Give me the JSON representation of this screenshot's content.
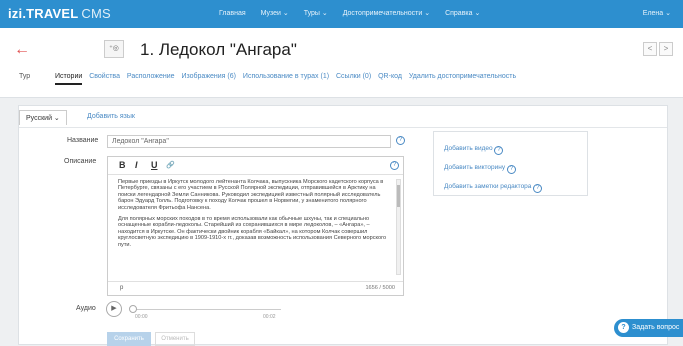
{
  "topbar": {
    "logo": "izi.TRAVEL",
    "logo_suffix": "CMS",
    "nav": [
      "Главная",
      "Музеи ⌄",
      "Туры ⌄",
      "Достопримечательности ⌄",
      "Справка ⌄"
    ],
    "user": "Елена ⌄"
  },
  "header": {
    "back_icon": "←",
    "thumb_icon": "camera-icon",
    "thumb_label": "⁺◎",
    "title": "1. Ледокол \"Ангара\"",
    "pager_prev": "<",
    "pager_next": ">",
    "type_label": "Тур",
    "tabs": [
      "Истории",
      "Свойства",
      "Расположение",
      "Изображения (6)",
      "Использование в турах (1)",
      "Ссылки (0)",
      "QR-код",
      "Удалить достопримечательность"
    ]
  },
  "lang": {
    "current": "Русский ⌄",
    "add": "Добавить язык"
  },
  "form": {
    "name_label": "Название",
    "name_value": "Ледокол \"Ангара\"",
    "desc_label": "Описание",
    "help": "?",
    "toolbar": {
      "bold": "B",
      "italic": "I",
      "underline": "U",
      "link": "🔗"
    },
    "paragraph1": "Первые приезды в Иркутск молодого лейтенанта Колчака, выпускника Морского кадетского корпуса в Петербурге, связаны с его участием в Русской Полярной экспедиции, отправившейся в Арктику на поиски легендарной Земли Санникова. Руководил экспедицией известный полярный исследователь барон Эдуард Толль. Подготовку к походу Колчак прошел в Норвегии, у знаменитого полярного исследователя Фритьофа Нансена.",
    "paragraph2": "Для полярных морских походов в то время использовали как обычные шхуны, так и специально оснащенные корабли-ледоколы. Старейший из сохранившихся в мире ледоколов, – «Ангара», – находится в Иркутске. Он фактически двойник корабля «Байкал», на котором Колчак совершил круглосветную экспедицию в 1909-1910-х гг., доказав возможность использования Северного морского пути.",
    "status_tag": "p",
    "char_count": "1656 / 5000",
    "audio_label": "Аудио",
    "audio_start": "00:00",
    "audio_end": "00:02",
    "save": "Сохранить",
    "cancel": "Отменить"
  },
  "sidebar": {
    "links": [
      "Добавить видео",
      "Добавить викторину",
      "Добавить заметки редактора"
    ]
  },
  "help_widget": {
    "label": "Задать вопрос"
  }
}
